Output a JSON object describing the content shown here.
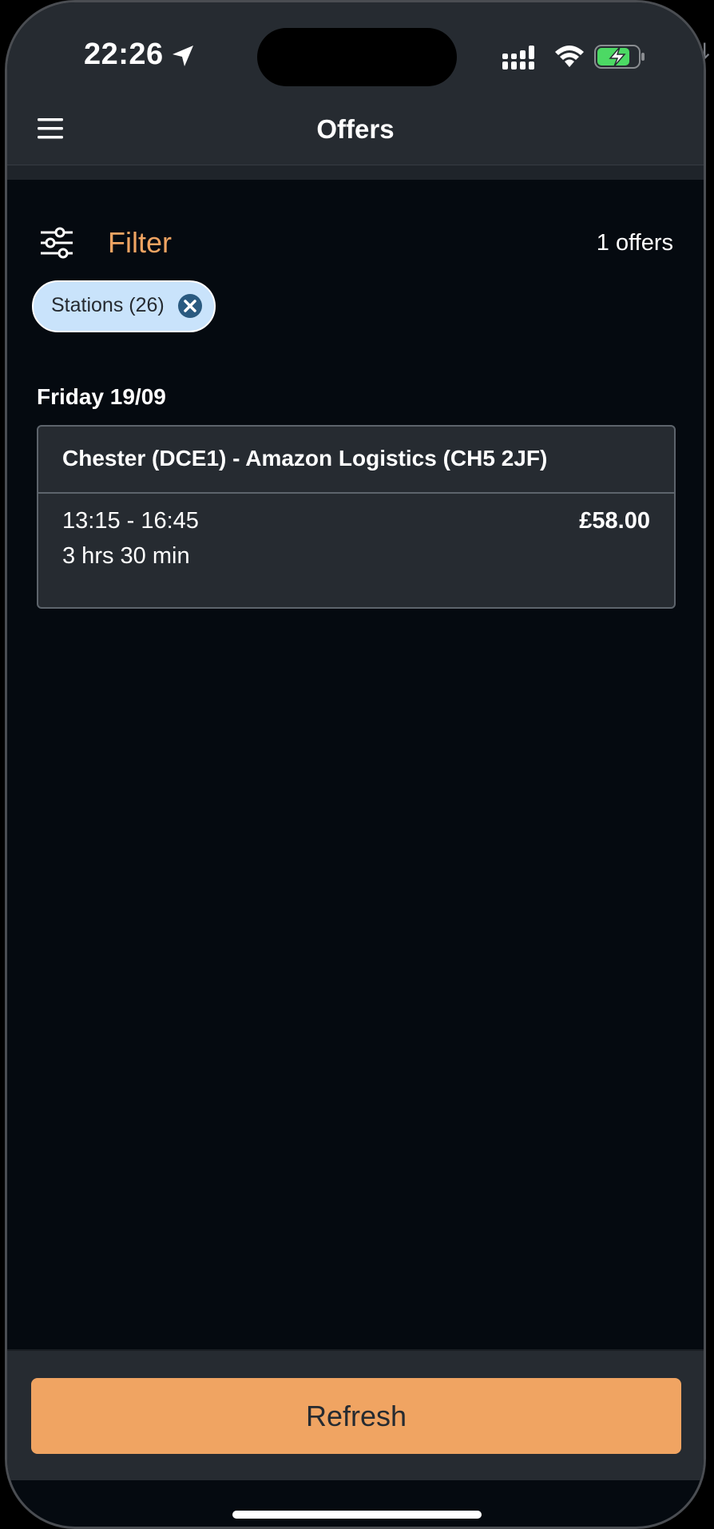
{
  "status_bar": {
    "time": "22:26",
    "icons": [
      "location-arrow-icon",
      "cellular-signal-icon",
      "wifi-icon",
      "battery-charging-icon"
    ],
    "battery_color": "#4cd964"
  },
  "header": {
    "title": "Offers",
    "menu_icon": "hamburger-menu-icon"
  },
  "filter": {
    "label": "Filter",
    "icon": "sliders-icon",
    "offer_count": "1 offers",
    "chips": [
      {
        "label": "Stations (26)",
        "remove_icon": "close-circle-icon"
      }
    ]
  },
  "offers": {
    "groups": [
      {
        "date": "Friday 19/09",
        "items": [
          {
            "station": "Chester (DCE1) - Amazon Logistics (CH5 2JF)",
            "time": "13:15 - 16:45",
            "duration": "3 hrs 30 min",
            "pay": "£58.00"
          }
        ]
      }
    ]
  },
  "footer": {
    "refresh_label": "Refresh"
  },
  "colors": {
    "accent": "#f0a462",
    "chip_background": "#c9e3fb",
    "chip_icon": "#2a5a80",
    "surface": "#262b31",
    "background": "#050a10"
  }
}
